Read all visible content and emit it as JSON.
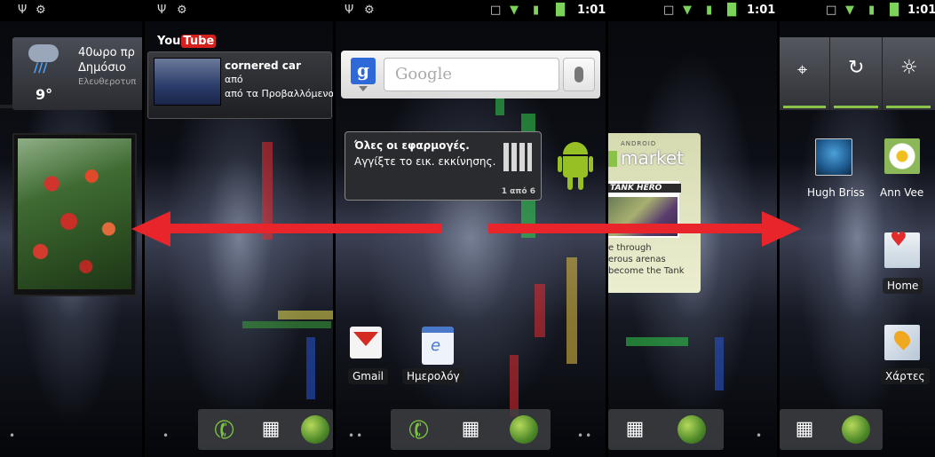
{
  "status": {
    "time": "1:01"
  },
  "weather": {
    "headline": "40ωρο πρ",
    "location": "Δημόσιο",
    "source": "Ελευθεροτυπ",
    "temp": "9°"
  },
  "youtube": {
    "logo_you": "You",
    "logo_tube": "Tube",
    "title": "cornered car",
    "line2": "από",
    "line3": "από τα Προβαλλόμενα"
  },
  "search": {
    "placeholder": "Google",
    "g_letter": "g"
  },
  "tip": {
    "title": "Όλες οι εφαρμογές.",
    "body": "Αγγίξτε το εικ. εκκίνησης.",
    "page": "1 από 6"
  },
  "market": {
    "brand_small": "ANDROID",
    "brand": "market",
    "game": "TANK HERO",
    "line1": "e through",
    "line2": "erous arenas",
    "line3": "become the Tank"
  },
  "home_apps": [
    {
      "label": "Gmail"
    },
    {
      "label": "Ημερολόγ"
    }
  ],
  "right_apps": [
    {
      "label": "Hugh Briss"
    },
    {
      "label": "Ann Vee"
    },
    {
      "label": "Home"
    },
    {
      "label": "Χάρτες"
    }
  ],
  "page_dots": {
    "left": "•",
    "center_left": "••",
    "center_right": "••",
    "right": "•"
  },
  "colors": {
    "arrow": "#e8252b",
    "accent_green": "#8bc34a",
    "status_bar": "#000000"
  }
}
